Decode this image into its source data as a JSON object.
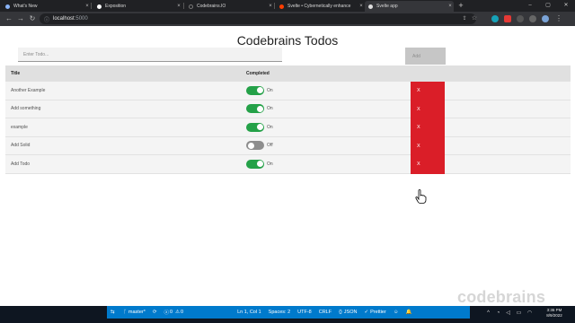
{
  "browser": {
    "tabs": [
      {
        "title": "What's New",
        "favicon_color": "#8ab4f8",
        "active": false
      },
      {
        "title": "Exposition",
        "favicon_color": "#ffffff",
        "active": false
      },
      {
        "title": "Codebrains.IO",
        "favicon_color": "#202124",
        "active": false
      },
      {
        "title": "Svelte • Cybernetically enhance",
        "favicon_color": "#ff3e00",
        "active": false
      },
      {
        "title": "Svelte app",
        "favicon_color": "#dddddd",
        "active": true
      }
    ],
    "url_host": "localhost",
    "url_port": ":5000",
    "new_tab": "+"
  },
  "app": {
    "title": "Codebrains Todos",
    "input_placeholder": "Enter Todo...",
    "add_label": "Add",
    "columns": {
      "title": "Title",
      "completed": "Completed"
    },
    "todos": [
      {
        "title": "Another Example",
        "completed": true,
        "state_label": "On"
      },
      {
        "title": "Add something",
        "completed": true,
        "state_label": "On"
      },
      {
        "title": "example",
        "completed": true,
        "state_label": "On"
      },
      {
        "title": "Add Solid",
        "completed": false,
        "state_label": "Off"
      },
      {
        "title": "Add Todo",
        "completed": true,
        "state_label": "On"
      }
    ],
    "delete_label": "X"
  },
  "statusbar": {
    "branch": "master*",
    "errors": "0",
    "warnings": "0",
    "position": "Ln 1, Col 1",
    "spaces": "Spaces: 2",
    "encoding": "UTF-8",
    "eol": "CRLF",
    "language": "JSON",
    "formatter": "Prettier"
  },
  "clock": {
    "time": "3:36 PM",
    "date": "8/9/2022"
  },
  "watermark": "codebrains",
  "colors": {
    "toggle_on": "#24a148",
    "toggle_off": "#8d8d8d",
    "delete": "#da1e28",
    "statusbar": "#007acc"
  },
  "icons": [
    "back-arrow-icon",
    "forward-arrow-icon",
    "reload-icon",
    "lock-icon",
    "share-icon",
    "star-icon",
    "pointer-hand-icon",
    "git-branch-icon",
    "sync-icon",
    "error-icon",
    "warning-icon",
    "check-icon",
    "feedback-icon",
    "bell-icon"
  ]
}
